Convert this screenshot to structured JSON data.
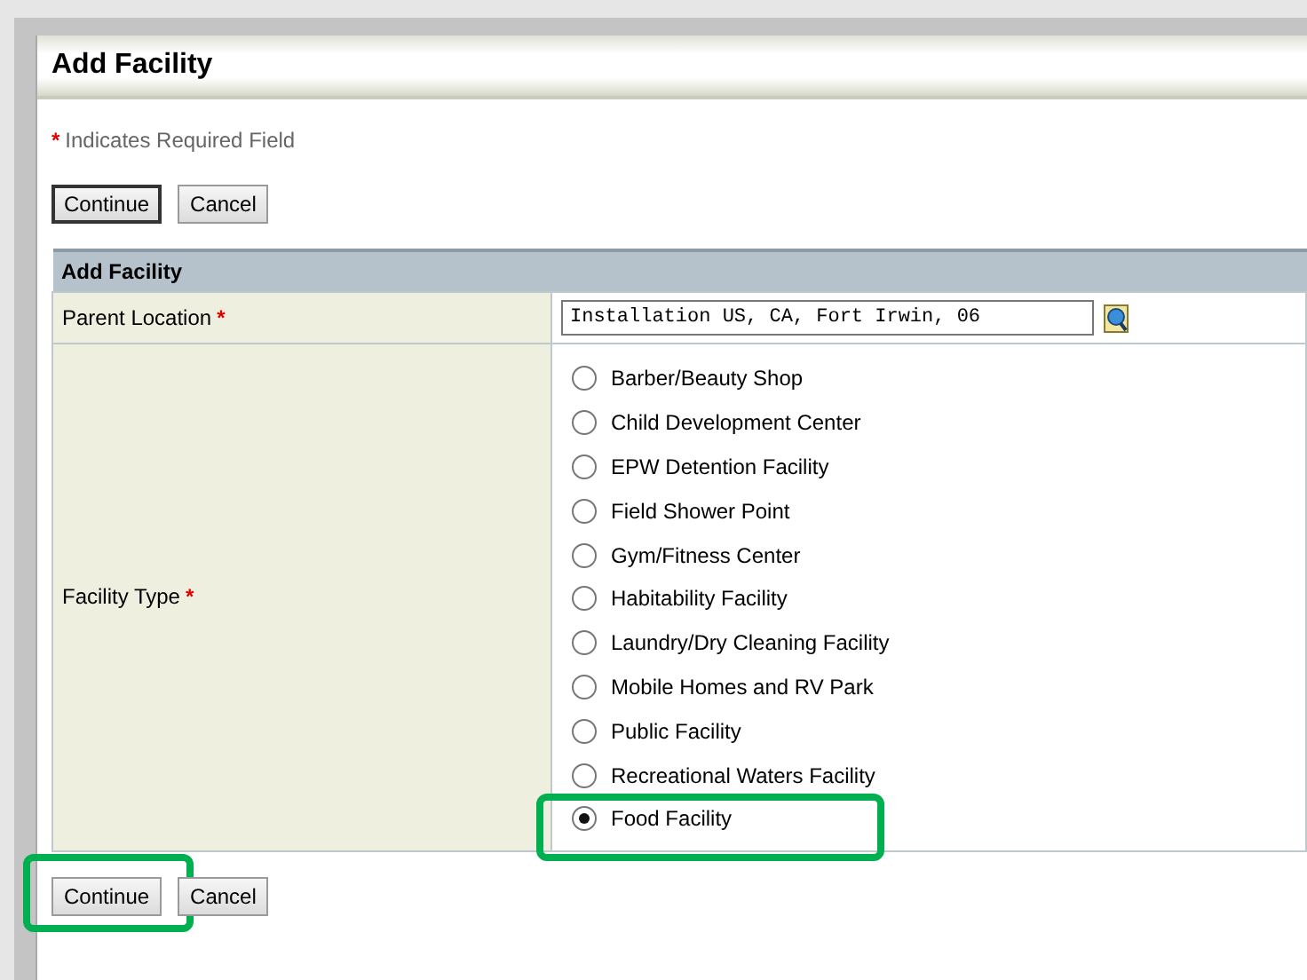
{
  "page": {
    "title": "Add Facility",
    "required_mark": "*",
    "required_note": "Indicates Required Field"
  },
  "top_buttons": [
    {
      "label": "Continue",
      "kind": "default"
    },
    {
      "label": "Cancel",
      "kind": "normal"
    }
  ],
  "form": {
    "title": "Add Facility",
    "parent_location": {
      "label": "Parent Location",
      "required_mark": "*",
      "value": "Installation US, CA, Fort Irwin, 06"
    },
    "facility_type": {
      "label": "Facility Type",
      "required_mark": "*",
      "options": [
        {
          "label": "Barber/Beauty Shop",
          "selected": false,
          "highlighted": false
        },
        {
          "label": "Child Development Center",
          "selected": false,
          "highlighted": false
        },
        {
          "label": "EPW Detention Facility",
          "selected": false,
          "highlighted": false
        },
        {
          "label": "Field Shower Point",
          "selected": false,
          "highlighted": false
        },
        {
          "label": "Gym/Fitness Center",
          "selected": false,
          "highlighted": false
        },
        {
          "label": "Habitability Facility",
          "selected": false,
          "highlighted": false
        },
        {
          "label": "Laundry/Dry Cleaning Facility",
          "selected": false,
          "highlighted": false
        },
        {
          "label": "Mobile Homes and RV Park",
          "selected": false,
          "highlighted": false
        },
        {
          "label": "Public Facility",
          "selected": false,
          "highlighted": false
        },
        {
          "label": "Recreational Waters Facility",
          "selected": false,
          "highlighted": false
        },
        {
          "label": "Food Facility",
          "selected": true,
          "highlighted": true
        }
      ]
    }
  },
  "bottom_buttons": [
    {
      "label": "Continue",
      "highlighted": true
    },
    {
      "label": "Cancel",
      "highlighted": false
    }
  ]
}
